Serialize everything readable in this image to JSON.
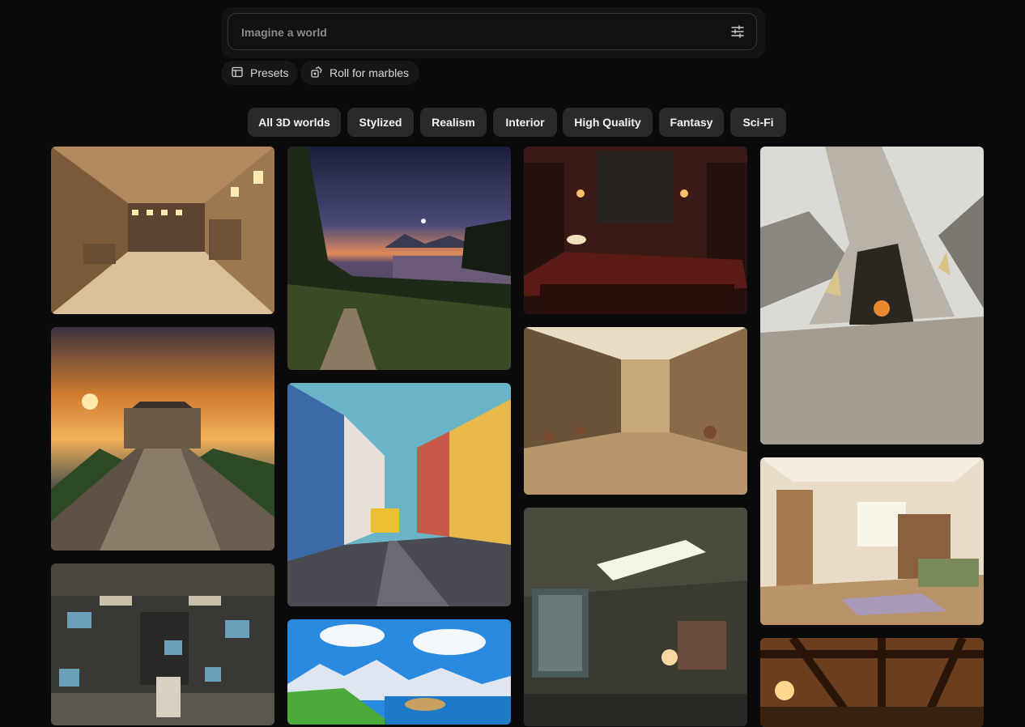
{
  "search": {
    "placeholder": "Imagine a world",
    "value": ""
  },
  "actions": {
    "presets_label": "Presets",
    "roll_label": "Roll for marbles"
  },
  "filters": [
    {
      "label": "All 3D worlds",
      "active": true
    },
    {
      "label": "Stylized",
      "active": false
    },
    {
      "label": "Realism",
      "active": false
    },
    {
      "label": "Interior",
      "active": false
    },
    {
      "label": "High Quality",
      "active": false
    },
    {
      "label": "Fantasy",
      "active": false
    },
    {
      "label": "Sci-Fi",
      "active": false
    }
  ],
  "gallery": [
    {
      "column": 1,
      "scene": "sandy-stone-chamber"
    },
    {
      "column": 1,
      "scene": "great-wall-sunset"
    },
    {
      "column": 1,
      "scene": "spaceship-control-room"
    },
    {
      "column": 2,
      "scene": "lake-twilight-forest"
    },
    {
      "column": 2,
      "scene": "colorful-tram-street"
    },
    {
      "column": 2,
      "scene": "cartoon-coast-mountains"
    },
    {
      "column": 3,
      "scene": "red-study-room"
    },
    {
      "column": 3,
      "scene": "desert-market-alley"
    },
    {
      "column": 3,
      "scene": "dim-bedroom-ceiling-light"
    },
    {
      "column": 4,
      "scene": "stone-tree-cave"
    },
    {
      "column": 4,
      "scene": "cozy-bedroom-bookshelves"
    },
    {
      "column": 4,
      "scene": "wooden-beam-ceiling"
    }
  ]
}
